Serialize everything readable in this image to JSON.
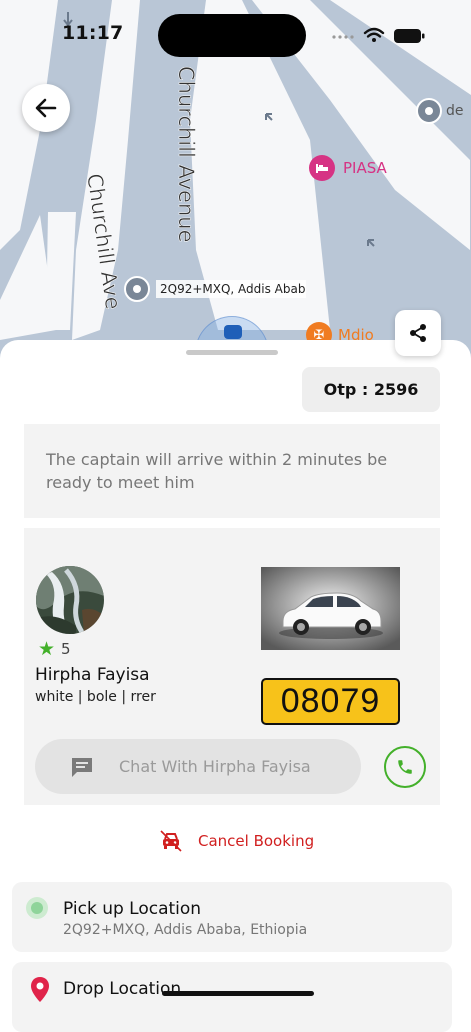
{
  "status_bar": {
    "time": "11:17"
  },
  "map": {
    "streets": [
      "Churchill Avenue",
      "Churchill Ave"
    ],
    "pois": [
      {
        "label": "PIASA",
        "icon": "hotel-icon",
        "color": "#d63384"
      },
      {
        "label": "2Q92+MXQ, Addis Ababa",
        "icon": "location-pin-icon"
      },
      {
        "label": "Mdio",
        "icon": "restaurant-icon",
        "color": "#f07c22"
      },
      {
        "label": "de",
        "icon": "location-pin-icon"
      }
    ]
  },
  "otp": {
    "label": "Otp : 2596"
  },
  "notice": {
    "text": "The captain will arrive within 2 minutes be ready to meet him"
  },
  "driver": {
    "rating": "5",
    "name": "Hirpha Fayisa",
    "details": "white | bole | rrer",
    "plate": "08079",
    "chat_label": "Chat With Hirpha Fayisa"
  },
  "actions": {
    "cancel_label": "Cancel Booking"
  },
  "pickup": {
    "title": "Pick up Location",
    "address": "2Q92+MXQ, Addis Ababa, Ethiopia"
  },
  "drop": {
    "title": "Drop Location",
    "address": ""
  },
  "colors": {
    "accent_green": "#43b02a",
    "cancel_red": "#d12020",
    "plate_yellow": "#f7c21a",
    "map_road": "#b9c6d6"
  }
}
